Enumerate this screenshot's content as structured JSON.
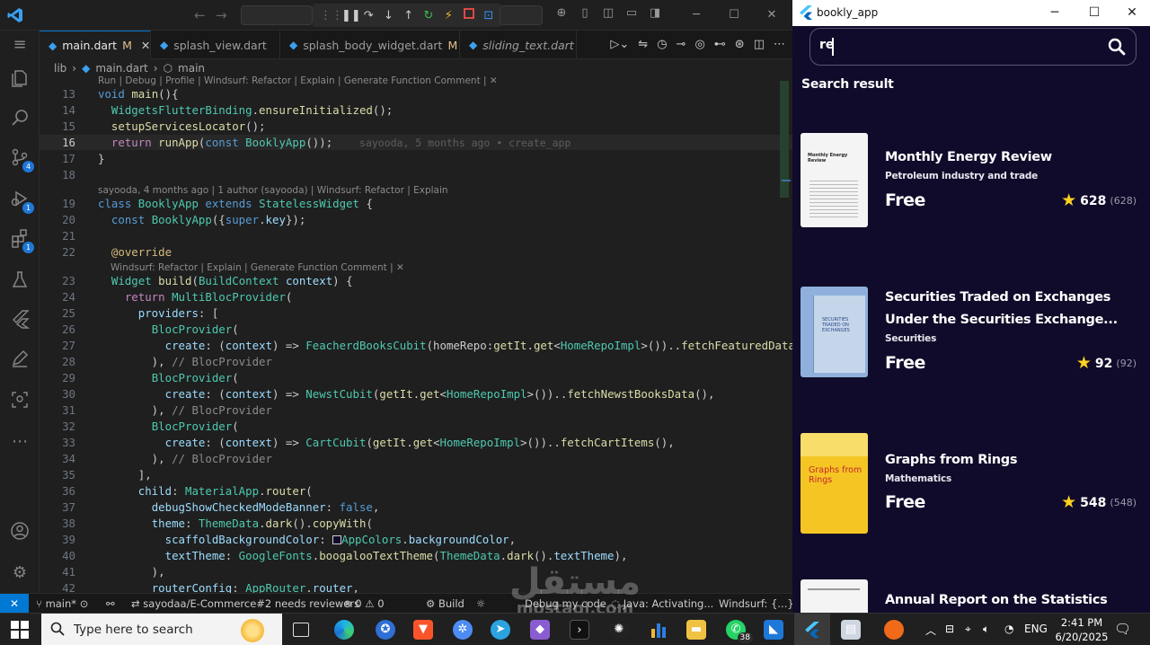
{
  "vscode": {
    "tabs": [
      {
        "label": "main.dart",
        "status": "M",
        "active": true,
        "italic": false
      },
      {
        "label": "splash_view.dart",
        "status": "",
        "active": false,
        "italic": false
      },
      {
        "label": "splash_body_widget.dart",
        "status": "M",
        "active": false,
        "italic": false
      },
      {
        "label": "sliding_text.dart",
        "status": "",
        "active": false,
        "italic": true
      }
    ],
    "breadcrumb": {
      "folder": "lib",
      "file": "main.dart",
      "symbol": "main"
    },
    "badges": {
      "source_control": "4",
      "run_debug": "1",
      "extensions": "1"
    },
    "lens": {
      "main": "Run | Debug | Profile | Windsurf: Refactor | Explain | Generate Function Comment | ✕",
      "class": "sayooda, 4 months ago | 1 author (sayooda) | Windsurf: Refactor | Explain",
      "build": "Windsurf: Refactor | Explain | Generate Function Comment | ✕"
    },
    "blame": "sayooda, 5 months ago • create_app",
    "line_numbers": [
      "13",
      "14",
      "15",
      "16",
      "17",
      "18",
      "19",
      "20",
      "21",
      "22",
      "23",
      "24",
      "25",
      "26",
      "27",
      "28",
      "29",
      "30",
      "31",
      "32",
      "33",
      "34",
      "35",
      "36",
      "37",
      "38",
      "39",
      "40",
      "41",
      "42"
    ],
    "status": {
      "branch": "main*",
      "pr": "sayodaa/E-Commerce#2 needs reviewers",
      "problems": "⊗ 0 ⚠ 0",
      "build": "Build",
      "debug": "Debug my code",
      "java": "Java: Activating...",
      "windsurf": "Windsurf: {...}"
    }
  },
  "app": {
    "window_title": "bookly_app",
    "search": {
      "value": "re"
    },
    "section_title": "Search result",
    "books": [
      {
        "title_lines": [
          "Monthly Energy Review"
        ],
        "author": "Petroleum industry and trade",
        "price": "Free",
        "rating": "628",
        "count": "(628)",
        "cover_color": "#f4f4f4",
        "cover_text": "Monthly Energy Review"
      },
      {
        "title_lines": [
          "Securities Traded on Exchanges",
          "Under the Securities Exchange..."
        ],
        "author": "Securities",
        "price": "Free",
        "rating": "92",
        "count": "(92)",
        "cover_color": "#8fb0dc",
        "cover_text": "SECURITIES TRADED ON EXCHANGES"
      },
      {
        "title_lines": [
          "Graphs from Rings"
        ],
        "author": "Mathematics",
        "price": "Free",
        "rating": "548",
        "count": "(548)",
        "cover_color": "#f5c623",
        "cover_text": "Graphs from Rings"
      },
      {
        "title_lines": [
          "Annual Report on the Statistics"
        ],
        "author": "",
        "price": "",
        "rating": "",
        "count": "",
        "cover_color": "#f4f4f4",
        "cover_text": ""
      }
    ]
  },
  "taskbar": {
    "search_placeholder": "Type here to search",
    "whatsapp_badge": "38",
    "lang": "ENG",
    "time": "2:41 PM",
    "date": "6/20/2025"
  },
  "watermark": {
    "main": "مستقل",
    "sub": "mostaql.com"
  }
}
